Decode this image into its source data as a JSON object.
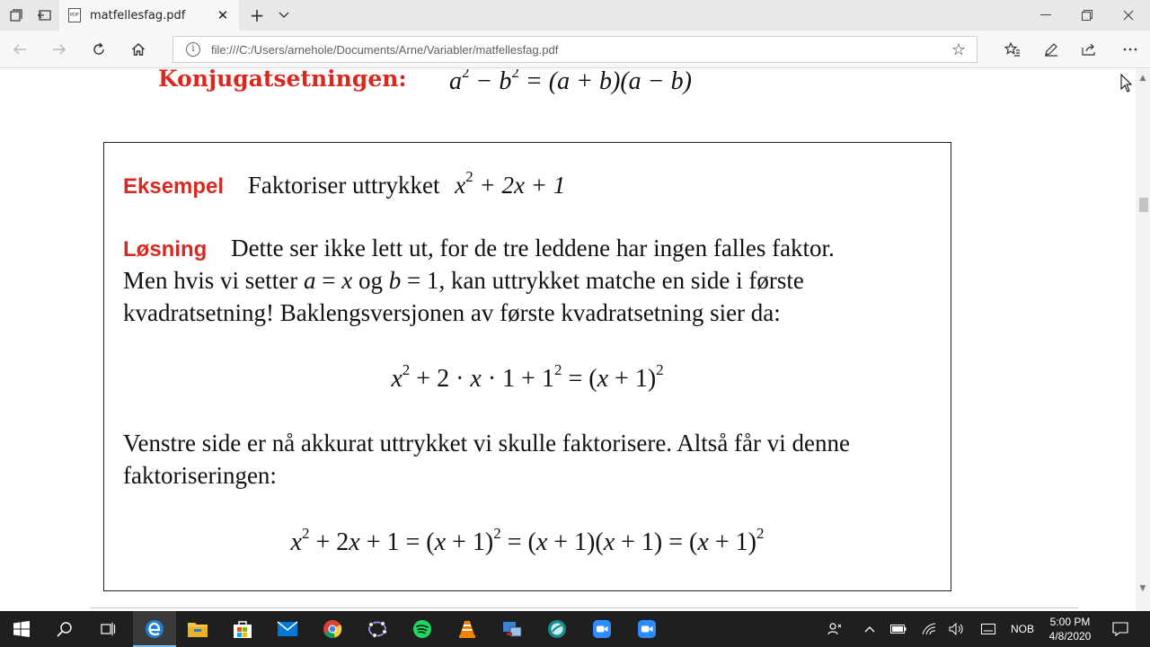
{
  "browser": {
    "tab_title": "matfellesfag.pdf",
    "tab_icon_label": "PDF",
    "url": "file:///C:/Users/arnehole/Documents/Arne/Variabler/matfellesfag.pdf",
    "new_tab_symbol": "+",
    "close_symbol": "✕"
  },
  "doc": {
    "konj_label": "Konjugatsetningen:",
    "eksempel_label": "Eksempel",
    "eksempel_text": "Faktoriser uttrykket",
    "losning_label": "Løsning",
    "losning_line1": "Dette ser ikke lett ut, for de tre leddene har ingen falles faktor.",
    "losning_line2a": "Men hvis vi setter",
    "losning_line2b": "og",
    "losning_line2c": ", kan uttrykket matche en side i første",
    "losning_line3": "kvadratsetning! Baklengsversjonen av første kvadratsetning sier da:",
    "venstre_line1": "Venstre side er nå akkurat uttrykket vi skulle faktorisere. Altså får vi denne",
    "venstre_line2": "faktoriseringen:"
  },
  "taskbar": {
    "lang": "NOB",
    "time": "5:00 PM",
    "date": "4/8/2020"
  },
  "colors": {
    "heading_red": "#d62a20",
    "taskbar": "#1f1f1f"
  },
  "icons": [
    "tab-actions-icon",
    "set-aside-icon",
    "back-icon",
    "forward-icon",
    "refresh-icon",
    "home-icon",
    "site-info-icon",
    "favorite-star-icon",
    "favorites-list-icon",
    "pen-icon",
    "share-icon",
    "more-icon",
    "windows-start-icon",
    "search-icon",
    "task-view-icon",
    "edge-icon",
    "file-explorer-icon",
    "store-icon",
    "mail-icon",
    "chrome-icon",
    "geogebra-icon",
    "spotify-icon",
    "vlc-icon",
    "network-app-icon",
    "app-icon",
    "zoom-icon",
    "zoom-meetings-icon"
  ]
}
